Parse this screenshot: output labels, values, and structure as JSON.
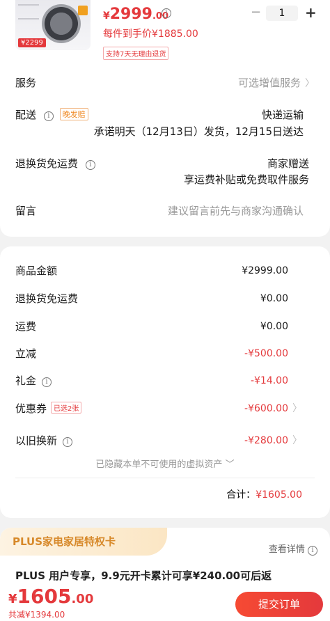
{
  "product": {
    "thumb_tag": "¥2299",
    "price_yen": "¥",
    "price_int": "2999",
    "price_cents": ".00",
    "final_price": "每件到手价¥1885.00",
    "return_tag": "支持7天无理由退货",
    "quantity": "1",
    "minus": "−",
    "plus": "+"
  },
  "rows": {
    "service_label": "服务",
    "service_value": "可选增值服务",
    "delivery_label": "配送",
    "delivery_tag": "晚发赔",
    "delivery_value": "快递运输",
    "delivery_promise": "承诺明天（12月13日）发货，12月15日送达",
    "return_label": "退换货免运费",
    "return_value": "商家赠送",
    "return_desc": "享运费补贴或免费取件服务",
    "message_label": "留言",
    "message_placeholder": "建议留言前先与商家沟通确认"
  },
  "costs": [
    {
      "label": "商品金额",
      "value": "¥2999.00",
      "red": false,
      "info": false,
      "chev": false,
      "tag": ""
    },
    {
      "label": "退换货免运费",
      "value": "¥0.00",
      "red": false,
      "info": false,
      "chev": false,
      "tag": ""
    },
    {
      "label": "运费",
      "value": "¥0.00",
      "red": false,
      "info": false,
      "chev": false,
      "tag": ""
    },
    {
      "label": "立减",
      "value": "-¥500.00",
      "red": true,
      "info": false,
      "chev": false,
      "tag": ""
    },
    {
      "label": "礼金",
      "value": "-¥14.00",
      "red": true,
      "info": true,
      "chev": false,
      "tag": ""
    },
    {
      "label": "优惠券",
      "value": "-¥600.00",
      "red": true,
      "info": false,
      "chev": true,
      "tag": "已选2张"
    },
    {
      "label": "以旧换新",
      "value": "-¥280.00",
      "red": true,
      "info": true,
      "chev": true,
      "tag": ""
    }
  ],
  "hidden_assets": "已隐藏本单不可使用的虚拟资产",
  "total_label": "合计：",
  "total_value": "¥1605.00",
  "plus": {
    "title": "PLUS家电家居特权卡",
    "detail": "查看详情",
    "text": "PLUS 用户专享，9.9元开卡累计可享¥240.00可后返"
  },
  "bottom": {
    "yen": "¥",
    "total_int": "1605",
    "total_cents": ".00",
    "saved": "共减¥1394.00",
    "submit": "提交订单"
  },
  "colors": {
    "accent": "#e4393c",
    "plus_gold": "#d7892a"
  }
}
